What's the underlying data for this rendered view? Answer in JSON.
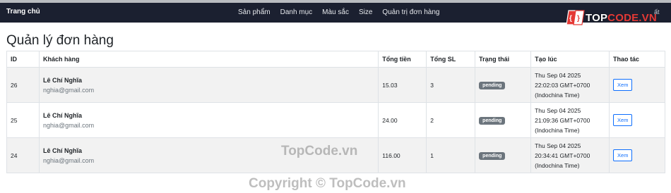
{
  "navbar": {
    "brand": "Trang chủ",
    "links": [
      "Sản phẩm",
      "Danh mục",
      "Màu sắc",
      "Size",
      "Quản trị đơn hàng"
    ],
    "right_fragment": "ất"
  },
  "logo": {
    "part1": "TOP",
    "part2": "CODE.VN"
  },
  "page": {
    "title": "Quản lý đơn hàng"
  },
  "table": {
    "headers": [
      "ID",
      "Khách hàng",
      "Tổng tiền",
      "Tổng SL",
      "Trạng thái",
      "Tạo lúc",
      "Thao tác"
    ],
    "rows": [
      {
        "id": "26",
        "name": "Lê Chí Nghĩa",
        "email": "nghia@gmail.com",
        "total": "15.03",
        "qty": "3",
        "status": "pending",
        "created": "Thu Sep 04 2025 22:02:03 GMT+0700 (Indochina Time)",
        "action": "Xem"
      },
      {
        "id": "25",
        "name": "Lê Chí Nghĩa",
        "email": "nghia@gmail.com",
        "total": "24.00",
        "qty": "2",
        "status": "pending",
        "created": "Thu Sep 04 2025 21:09:36 GMT+0700 (Indochina Time)",
        "action": "Xem"
      },
      {
        "id": "24",
        "name": "Lê Chí Nghĩa",
        "email": "nghia@gmail.com",
        "total": "116.00",
        "qty": "1",
        "status": "pending",
        "created": "Thu Sep 04 2025 20:34:41 GMT+0700 (Indochina Time)",
        "action": "Xem"
      }
    ]
  },
  "watermarks": {
    "center": "TopCode.vn",
    "bottom": "Copyright © TopCode.vn"
  },
  "colors": {
    "navbar_bg": "#1b2030",
    "badge_bg": "#6c757d",
    "button_primary": "#0d6efd",
    "logo_red": "#e53935"
  }
}
